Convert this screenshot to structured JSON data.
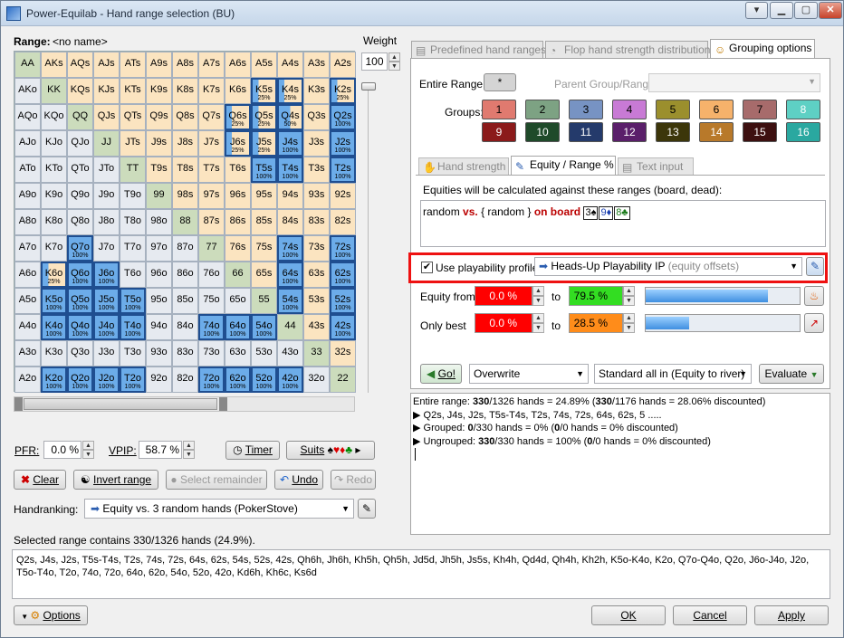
{
  "window": {
    "title": "Power-Equilab - Hand range selection (BU)"
  },
  "range": {
    "label": "Range:",
    "name": "<no name>"
  },
  "weight": {
    "label": "Weight",
    "value": "100"
  },
  "grid": [
    [
      {
        "t": "AA",
        "k": "pair"
      },
      {
        "t": "AKs",
        "k": "suited"
      },
      {
        "t": "AQs",
        "k": "suited"
      },
      {
        "t": "AJs",
        "k": "suited"
      },
      {
        "t": "ATs",
        "k": "suited"
      },
      {
        "t": "A9s",
        "k": "suited"
      },
      {
        "t": "A8s",
        "k": "suited"
      },
      {
        "t": "A7s",
        "k": "suited"
      },
      {
        "t": "A6s",
        "k": "suited"
      },
      {
        "t": "A5s",
        "k": "suited"
      },
      {
        "t": "A4s",
        "k": "suited"
      },
      {
        "t": "A3s",
        "k": "suited"
      },
      {
        "t": "A2s",
        "k": "suited"
      }
    ],
    [
      {
        "t": "AKo",
        "k": "off"
      },
      {
        "t": "KK",
        "k": "pair"
      },
      {
        "t": "KQs",
        "k": "suited"
      },
      {
        "t": "KJs",
        "k": "suited"
      },
      {
        "t": "KTs",
        "k": "suited"
      },
      {
        "t": "K9s",
        "k": "suited"
      },
      {
        "t": "K8s",
        "k": "suited"
      },
      {
        "t": "K7s",
        "k": "suited"
      },
      {
        "t": "K6s",
        "k": "suited"
      },
      {
        "t": "K5s",
        "k": "part",
        "p": "25%"
      },
      {
        "t": "K4s",
        "k": "part",
        "p": "25%"
      },
      {
        "t": "K3s",
        "k": "suited"
      },
      {
        "t": "K2s",
        "k": "part",
        "p": "25%"
      }
    ],
    [
      {
        "t": "AQo",
        "k": "off"
      },
      {
        "t": "KQo",
        "k": "off"
      },
      {
        "t": "QQ",
        "k": "pair"
      },
      {
        "t": "QJs",
        "k": "suited"
      },
      {
        "t": "QTs",
        "k": "suited"
      },
      {
        "t": "Q9s",
        "k": "suited"
      },
      {
        "t": "Q8s",
        "k": "suited"
      },
      {
        "t": "Q7s",
        "k": "suited"
      },
      {
        "t": "Q6s",
        "k": "part",
        "p": "25%"
      },
      {
        "t": "Q5s",
        "k": "part",
        "p": "25%"
      },
      {
        "t": "Q4s",
        "k": "part",
        "p": "50%"
      },
      {
        "t": "Q3s",
        "k": "suited"
      },
      {
        "t": "Q2s",
        "k": "sel",
        "p": "100%"
      }
    ],
    [
      {
        "t": "AJo",
        "k": "off"
      },
      {
        "t": "KJo",
        "k": "off"
      },
      {
        "t": "QJo",
        "k": "off"
      },
      {
        "t": "JJ",
        "k": "pair"
      },
      {
        "t": "JTs",
        "k": "suited"
      },
      {
        "t": "J9s",
        "k": "suited"
      },
      {
        "t": "J8s",
        "k": "suited"
      },
      {
        "t": "J7s",
        "k": "suited"
      },
      {
        "t": "J6s",
        "k": "part",
        "p": "25%"
      },
      {
        "t": "J5s",
        "k": "part",
        "p": "25%"
      },
      {
        "t": "J4s",
        "k": "sel",
        "p": "100%"
      },
      {
        "t": "J3s",
        "k": "suited"
      },
      {
        "t": "J2s",
        "k": "sel",
        "p": "100%"
      }
    ],
    [
      {
        "t": "ATo",
        "k": "off"
      },
      {
        "t": "KTo",
        "k": "off"
      },
      {
        "t": "QTo",
        "k": "off"
      },
      {
        "t": "JTo",
        "k": "off"
      },
      {
        "t": "TT",
        "k": "pair"
      },
      {
        "t": "T9s",
        "k": "suited"
      },
      {
        "t": "T8s",
        "k": "suited"
      },
      {
        "t": "T7s",
        "k": "suited"
      },
      {
        "t": "T6s",
        "k": "suited"
      },
      {
        "t": "T5s",
        "k": "sel",
        "p": "100%"
      },
      {
        "t": "T4s",
        "k": "sel",
        "p": "100%"
      },
      {
        "t": "T3s",
        "k": "suited"
      },
      {
        "t": "T2s",
        "k": "sel",
        "p": "100%"
      }
    ],
    [
      {
        "t": "A9o",
        "k": "off"
      },
      {
        "t": "K9o",
        "k": "off"
      },
      {
        "t": "Q9o",
        "k": "off"
      },
      {
        "t": "J9o",
        "k": "off"
      },
      {
        "t": "T9o",
        "k": "off"
      },
      {
        "t": "99",
        "k": "pair"
      },
      {
        "t": "98s",
        "k": "suited"
      },
      {
        "t": "97s",
        "k": "suited"
      },
      {
        "t": "96s",
        "k": "suited"
      },
      {
        "t": "95s",
        "k": "suited"
      },
      {
        "t": "94s",
        "k": "suited"
      },
      {
        "t": "93s",
        "k": "suited"
      },
      {
        "t": "92s",
        "k": "suited"
      }
    ],
    [
      {
        "t": "A8o",
        "k": "off"
      },
      {
        "t": "K8o",
        "k": "off"
      },
      {
        "t": "Q8o",
        "k": "off"
      },
      {
        "t": "J8o",
        "k": "off"
      },
      {
        "t": "T8o",
        "k": "off"
      },
      {
        "t": "98o",
        "k": "off"
      },
      {
        "t": "88",
        "k": "pair"
      },
      {
        "t": "87s",
        "k": "suited"
      },
      {
        "t": "86s",
        "k": "suited"
      },
      {
        "t": "85s",
        "k": "suited"
      },
      {
        "t": "84s",
        "k": "suited"
      },
      {
        "t": "83s",
        "k": "suited"
      },
      {
        "t": "82s",
        "k": "suited"
      }
    ],
    [
      {
        "t": "A7o",
        "k": "off"
      },
      {
        "t": "K7o",
        "k": "off"
      },
      {
        "t": "Q7o",
        "k": "sel",
        "p": "100%"
      },
      {
        "t": "J7o",
        "k": "off"
      },
      {
        "t": "T7o",
        "k": "off"
      },
      {
        "t": "97o",
        "k": "off"
      },
      {
        "t": "87o",
        "k": "off"
      },
      {
        "t": "77",
        "k": "pair"
      },
      {
        "t": "76s",
        "k": "suited"
      },
      {
        "t": "75s",
        "k": "suited"
      },
      {
        "t": "74s",
        "k": "sel",
        "p": "100%"
      },
      {
        "t": "73s",
        "k": "suited"
      },
      {
        "t": "72s",
        "k": "sel",
        "p": "100%"
      }
    ],
    [
      {
        "t": "A6o",
        "k": "off"
      },
      {
        "t": "K6o",
        "k": "part",
        "p": "25%"
      },
      {
        "t": "Q6o",
        "k": "sel",
        "p": "100%"
      },
      {
        "t": "J6o",
        "k": "sel",
        "p": "100%"
      },
      {
        "t": "T6o",
        "k": "off"
      },
      {
        "t": "96o",
        "k": "off"
      },
      {
        "t": "86o",
        "k": "off"
      },
      {
        "t": "76o",
        "k": "off"
      },
      {
        "t": "66",
        "k": "pair"
      },
      {
        "t": "65s",
        "k": "suited"
      },
      {
        "t": "64s",
        "k": "sel",
        "p": "100%"
      },
      {
        "t": "63s",
        "k": "suited"
      },
      {
        "t": "62s",
        "k": "sel",
        "p": "100%"
      }
    ],
    [
      {
        "t": "A5o",
        "k": "off"
      },
      {
        "t": "K5o",
        "k": "sel",
        "p": "100%"
      },
      {
        "t": "Q5o",
        "k": "sel",
        "p": "100%"
      },
      {
        "t": "J5o",
        "k": "sel",
        "p": "100%"
      },
      {
        "t": "T5o",
        "k": "sel",
        "p": "100%"
      },
      {
        "t": "95o",
        "k": "off"
      },
      {
        "t": "85o",
        "k": "off"
      },
      {
        "t": "75o",
        "k": "off"
      },
      {
        "t": "65o",
        "k": "off"
      },
      {
        "t": "55",
        "k": "pair"
      },
      {
        "t": "54s",
        "k": "sel",
        "p": "100%"
      },
      {
        "t": "53s",
        "k": "suited"
      },
      {
        "t": "52s",
        "k": "sel",
        "p": "100%"
      }
    ],
    [
      {
        "t": "A4o",
        "k": "off"
      },
      {
        "t": "K4o",
        "k": "sel",
        "p": "100%"
      },
      {
        "t": "Q4o",
        "k": "sel",
        "p": "100%"
      },
      {
        "t": "J4o",
        "k": "sel",
        "p": "100%"
      },
      {
        "t": "T4o",
        "k": "sel",
        "p": "100%"
      },
      {
        "t": "94o",
        "k": "off"
      },
      {
        "t": "84o",
        "k": "off"
      },
      {
        "t": "74o",
        "k": "sel",
        "p": "100%"
      },
      {
        "t": "64o",
        "k": "sel",
        "p": "100%"
      },
      {
        "t": "54o",
        "k": "sel",
        "p": "100%"
      },
      {
        "t": "44",
        "k": "pair"
      },
      {
        "t": "43s",
        "k": "suited"
      },
      {
        "t": "42s",
        "k": "sel",
        "p": "100%"
      }
    ],
    [
      {
        "t": "A3o",
        "k": "off"
      },
      {
        "t": "K3o",
        "k": "off"
      },
      {
        "t": "Q3o",
        "k": "off"
      },
      {
        "t": "J3o",
        "k": "off"
      },
      {
        "t": "T3o",
        "k": "off"
      },
      {
        "t": "93o",
        "k": "off"
      },
      {
        "t": "83o",
        "k": "off"
      },
      {
        "t": "73o",
        "k": "off"
      },
      {
        "t": "63o",
        "k": "off"
      },
      {
        "t": "53o",
        "k": "off"
      },
      {
        "t": "43o",
        "k": "off"
      },
      {
        "t": "33",
        "k": "pair"
      },
      {
        "t": "32s",
        "k": "suited"
      }
    ],
    [
      {
        "t": "A2o",
        "k": "off"
      },
      {
        "t": "K2o",
        "k": "sel",
        "p": "100%"
      },
      {
        "t": "Q2o",
        "k": "sel",
        "p": "100%"
      },
      {
        "t": "J2o",
        "k": "sel",
        "p": "100%"
      },
      {
        "t": "T2o",
        "k": "sel",
        "p": "100%"
      },
      {
        "t": "92o",
        "k": "off"
      },
      {
        "t": "82o",
        "k": "off"
      },
      {
        "t": "72o",
        "k": "sel",
        "p": "100%"
      },
      {
        "t": "62o",
        "k": "sel",
        "p": "100%"
      },
      {
        "t": "52o",
        "k": "sel",
        "p": "100%"
      },
      {
        "t": "42o",
        "k": "sel",
        "p": "100%"
      },
      {
        "t": "32o",
        "k": "off"
      },
      {
        "t": "22",
        "k": "pair"
      }
    ]
  ],
  "pfr": {
    "label": "PFR:",
    "value": "0.0 %"
  },
  "vpip": {
    "label": "VPIP:",
    "value": "58.7 %"
  },
  "buttons": {
    "timer": "Timer",
    "suits": "Suits",
    "clear": "Clear",
    "invert": "Invert range",
    "select_remainder": "Select remainder",
    "undo": "Undo",
    "redo": "Redo",
    "options": "Options",
    "ok": "OK",
    "cancel": "Cancel",
    "apply": "Apply",
    "go": "Go!",
    "evaluate": "Evaluate"
  },
  "handranking": {
    "label": "Handranking:",
    "value": "Equity vs. 3 random hands (PokerStove)"
  },
  "selected_summary": "Selected range contains 330/1326 hands (24.9%).",
  "hand_list": "Q2s, J4s, J2s, T5s-T4s, T2s, 74s, 72s, 64s, 62s, 54s, 52s, 42s, Qh6h, Jh6h, Kh5h, Qh5h, Jd5d, Jh5h, Js5s, Kh4h, Qd4d, Qh4h, Kh2h, K5o-K4o, K2o, Q7o-Q4o, Q2o, J6o-J4o, J2o, T5o-T4o, T2o, 74o, 72o, 64o, 62o, 54o, 52o, 42o, Kd6h, Kh6c, Ks6d",
  "top_tabs": [
    "Predefined hand ranges",
    "Flop hand strength distribution",
    "Grouping options"
  ],
  "grouping": {
    "entire_range_label": "Entire Range:",
    "entire_range_btn": "*",
    "parent_label": "Parent Group/Range:",
    "groups_label": "Groups:"
  },
  "groups": [
    {
      "n": "1",
      "bg": "#e07a6f",
      "fg": "#000"
    },
    {
      "n": "2",
      "bg": "#7da283",
      "fg": "#000"
    },
    {
      "n": "3",
      "bg": "#7793c3",
      "fg": "#000"
    },
    {
      "n": "4",
      "bg": "#c87ad5",
      "fg": "#000"
    },
    {
      "n": "5",
      "bg": "#9b8f2d",
      "fg": "#000"
    },
    {
      "n": "6",
      "bg": "#f6b26b",
      "fg": "#000"
    },
    {
      "n": "7",
      "bg": "#a76b6b",
      "fg": "#000"
    },
    {
      "n": "8",
      "bg": "#5ed0c4",
      "fg": "#fff"
    },
    {
      "n": "9",
      "bg": "#8b1a1a",
      "fg": "#fff"
    },
    {
      "n": "10",
      "bg": "#1f4a2a",
      "fg": "#fff"
    },
    {
      "n": "11",
      "bg": "#243a6b",
      "fg": "#fff"
    },
    {
      "n": "12",
      "bg": "#5a1f6a",
      "fg": "#fff"
    },
    {
      "n": "13",
      "bg": "#3c360a",
      "fg": "#fff"
    },
    {
      "n": "14",
      "bg": "#b8792a",
      "fg": "#fff"
    },
    {
      "n": "15",
      "bg": "#3d1010",
      "fg": "#fff"
    },
    {
      "n": "16",
      "bg": "#2aa8a0",
      "fg": "#fff"
    }
  ],
  "sub_tabs": [
    "Hand strength",
    "Equity / Range %",
    "Text input"
  ],
  "equity": {
    "desc": "Equities will be calculated against these ranges (board, dead):",
    "random1": "random",
    "vs": "vs.",
    "open_brace": "{",
    "random2": "random",
    "close_brace": "}",
    "on_board": "on board",
    "cards": [
      "3♠",
      "9♦",
      "8♣"
    ]
  },
  "playability": {
    "checkbox_label": "Use playability profile:",
    "profile": "Heads-Up Playability IP",
    "profile_note": "(equity offsets)"
  },
  "equity_from": {
    "label": "Equity from",
    "from": "0.0 %",
    "to_label": "to",
    "to": "79.5 %"
  },
  "only_best": {
    "label": "Only best",
    "from": "0.0 %",
    "to_label": "to",
    "to": "28.5 %"
  },
  "go_row": {
    "mode": "Overwrite",
    "calc": "Standard all in (Equity to river)"
  },
  "results": {
    "line1_prefix": "Entire range: ",
    "line1_a": "330",
    "line1_b": "/1326 hands = 24.89%  (",
    "line1_c": "330",
    "line1_d": "/1176 hands = 28.06% discounted)",
    "line2": "Q2s, J4s, J2s, T5s-T4s, T2s, 74s, 72s, 64s, 62s, 5 .....",
    "line3_prefix": "Grouped: ",
    "line3_a": "0",
    "line3_b": "/330 hands = 0%  (",
    "line3_c": "0",
    "line3_d": "/0 hands = 0% discounted)",
    "line4_prefix": "Ungrouped: ",
    "line4_a": "330",
    "line4_b": "/330 hands = 100%  (",
    "line4_c": "0",
    "line4_d": "/0 hands = 0% discounted)"
  },
  "colors": {
    "highlight": "#ee1111",
    "selected": "#6cace9",
    "suited": "#fbe4c0",
    "pair": "#ccdcbc"
  }
}
